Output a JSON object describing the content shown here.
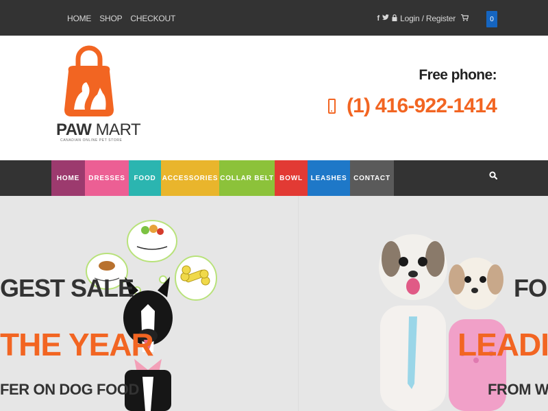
{
  "topbar": {
    "nav": [
      "HOME",
      "SHOP",
      "CHECKOUT"
    ],
    "login_label": "Login / Register",
    "cart_count": "0"
  },
  "header": {
    "logo_word1": "PAW",
    "logo_word2": "MART",
    "logo_tagline": "CANADIAN ONLINE PET STORE",
    "free_phone_label": "Free phone:",
    "phone_number": "(1) 416-922-1414"
  },
  "menu": [
    {
      "label": "HOME",
      "color": "#9c3a6e"
    },
    {
      "label": "DRESSES",
      "color": "#ec5f94"
    },
    {
      "label": "FOOD",
      "color": "#2bb5b0"
    },
    {
      "label": "ACCESSORIES",
      "color": "#e9b52c"
    },
    {
      "label": "COLLAR BELT",
      "color": "#8cc23a"
    },
    {
      "label": "BOWL",
      "color": "#e23a34"
    },
    {
      "label": "LEASHES",
      "color": "#1e78c8"
    },
    {
      "label": "CONTACT",
      "color": "#5a5a5a"
    }
  ],
  "slides": {
    "left": {
      "line1": "GEST SALE",
      "line2": "THE YEAR",
      "line3": "FER ON DOG FOOD"
    },
    "right": {
      "line1": "FOR",
      "line2": "LEADING",
      "line3": "FROM WET N"
    }
  },
  "colors": {
    "topbar_bg": "#333333",
    "accent_orange": "#f26522",
    "cart_badge": "#1565c0",
    "hero_bg": "#e6e6e6"
  },
  "icons": [
    "facebook-icon",
    "twitter-icon",
    "lock-icon",
    "cart-icon",
    "mobile-phone-icon",
    "search-icon"
  ]
}
